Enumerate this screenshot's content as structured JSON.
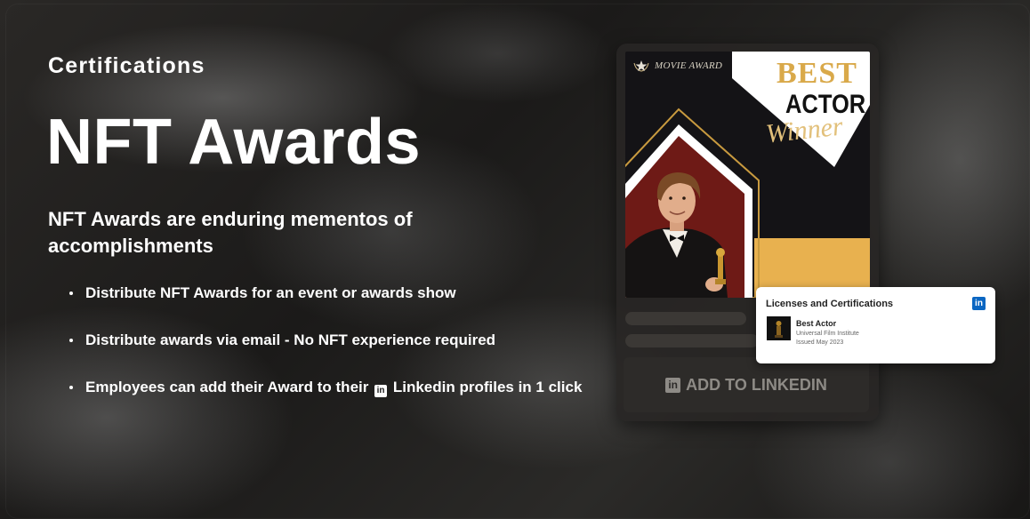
{
  "hero": {
    "eyebrow": "Certifications",
    "title": "NFT Awards",
    "subtitle": "NFT Awards are enduring mementos of accomplishments",
    "bullets": [
      "Distribute NFT Awards for an event or awards show",
      "Distribute awards via email - No NFT experience required"
    ],
    "bullet3_before": "Employees can add their Award to their",
    "bullet3_badge": "in",
    "bullet3_after": "Linkedin profiles in 1 click"
  },
  "poster": {
    "tag": "MOVIE AWARD",
    "best": "BEST",
    "actor": "ACTOR",
    "winner": "Winner"
  },
  "card": {
    "button_badge": "in",
    "button_label": "ADD TO LINKEDIN"
  },
  "license_card": {
    "header": "Licenses and Certifications",
    "logo": "in",
    "name": "Best Actor",
    "org": "Universal Film Institute",
    "issued": "Issued May 2023"
  },
  "colors": {
    "gold": "#d9a94a",
    "linkedin_blue": "#0a66c2",
    "poster_bg": "#141316"
  },
  "icons": [
    "star-icon",
    "linkedin-icon"
  ]
}
